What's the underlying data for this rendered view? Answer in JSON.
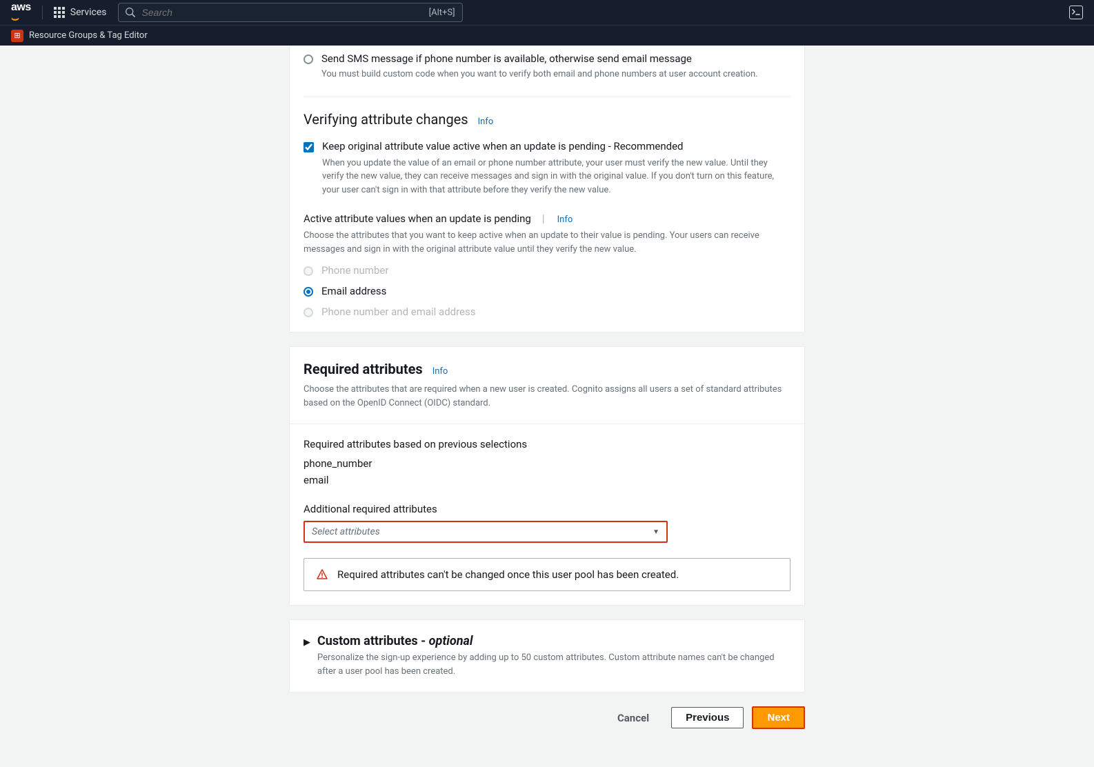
{
  "nav": {
    "services": "Services",
    "search_placeholder": "Search",
    "search_shortcut": "[Alt+S]",
    "resource_groups": "Resource Groups & Tag Editor"
  },
  "sms_radio": {
    "label": "Send SMS message if phone number is available, otherwise send email message",
    "helper": "You must build custom code when you want to verify both email and phone numbers at user account creation."
  },
  "verifying_section": {
    "title": "Verifying attribute changes",
    "info": "Info",
    "checkbox_label": "Keep original attribute value active when an update is pending - Recommended",
    "checkbox_helper": "When you update the value of an email or phone number attribute, your user must verify the new value. Until they verify the new value, they can receive messages and sign in with the original value. If you don't turn on this feature, your user can't sign in with that attribute before they verify the new value."
  },
  "active_attrs": {
    "title": "Active attribute values when an update is pending",
    "info": "Info",
    "helper": "Choose the attributes that you want to keep active when an update to their value is pending. Your users can receive messages and sign in with the original attribute value until they verify the new value.",
    "options": {
      "phone": "Phone number",
      "email": "Email address",
      "both": "Phone number and email address"
    }
  },
  "required_attrs": {
    "title": "Required attributes",
    "info": "Info",
    "desc": "Choose the attributes that are required when a new user is created. Cognito assigns all users a set of standard attributes based on the OpenID Connect (OIDC) standard.",
    "based_on_label": "Required attributes based on previous selections",
    "values": {
      "phone": "phone_number",
      "email": "email"
    },
    "additional_label": "Additional required attributes",
    "select_placeholder": "Select attributes",
    "warning": "Required attributes can't be changed once this user pool has been created."
  },
  "custom_attrs": {
    "title": "Custom attributes - ",
    "optional": "optional",
    "desc": "Personalize the sign-up experience by adding up to 50 custom attributes. Custom attribute names can't be changed after a user pool has been created."
  },
  "buttons": {
    "cancel": "Cancel",
    "previous": "Previous",
    "next": "Next"
  }
}
